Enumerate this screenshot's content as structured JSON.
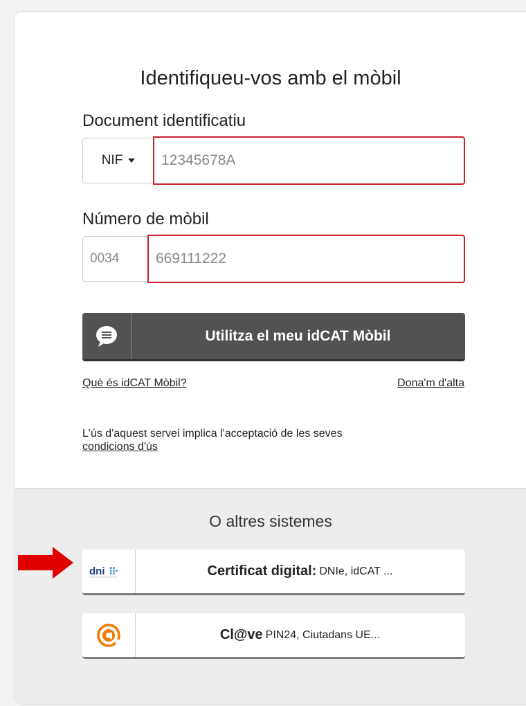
{
  "title": "Identifiqueu-vos amb el mòbil",
  "document": {
    "label": "Document identificatiu",
    "type_selected": "NIF",
    "placeholder": "12345678A"
  },
  "mobile": {
    "label": "Número de mòbil",
    "prefix": "0034",
    "placeholder": "669111222"
  },
  "idcat_button": {
    "label": "Utilitza el meu idCAT Mòbil"
  },
  "links": {
    "what_is": "Què és idCAT Mòbil?",
    "signup": "Dona'm d'alta"
  },
  "terms": {
    "text": "L'ús d'aquest servei implica l'acceptació de les seves",
    "link": "condicions d'ús"
  },
  "other": {
    "title": "O altres sistemes",
    "certificate": {
      "title": "Certificat digital:",
      "detail": "DNIe, idCAT ...",
      "icon_text": "dni"
    },
    "clave": {
      "title": "Cl@ve",
      "detail": "PIN24, Ciutadans UE..."
    }
  },
  "colors": {
    "error_border": "#c8202a",
    "primary_button": "#525252",
    "arrow": "#e00000",
    "clave_orange": "#f07a00"
  }
}
